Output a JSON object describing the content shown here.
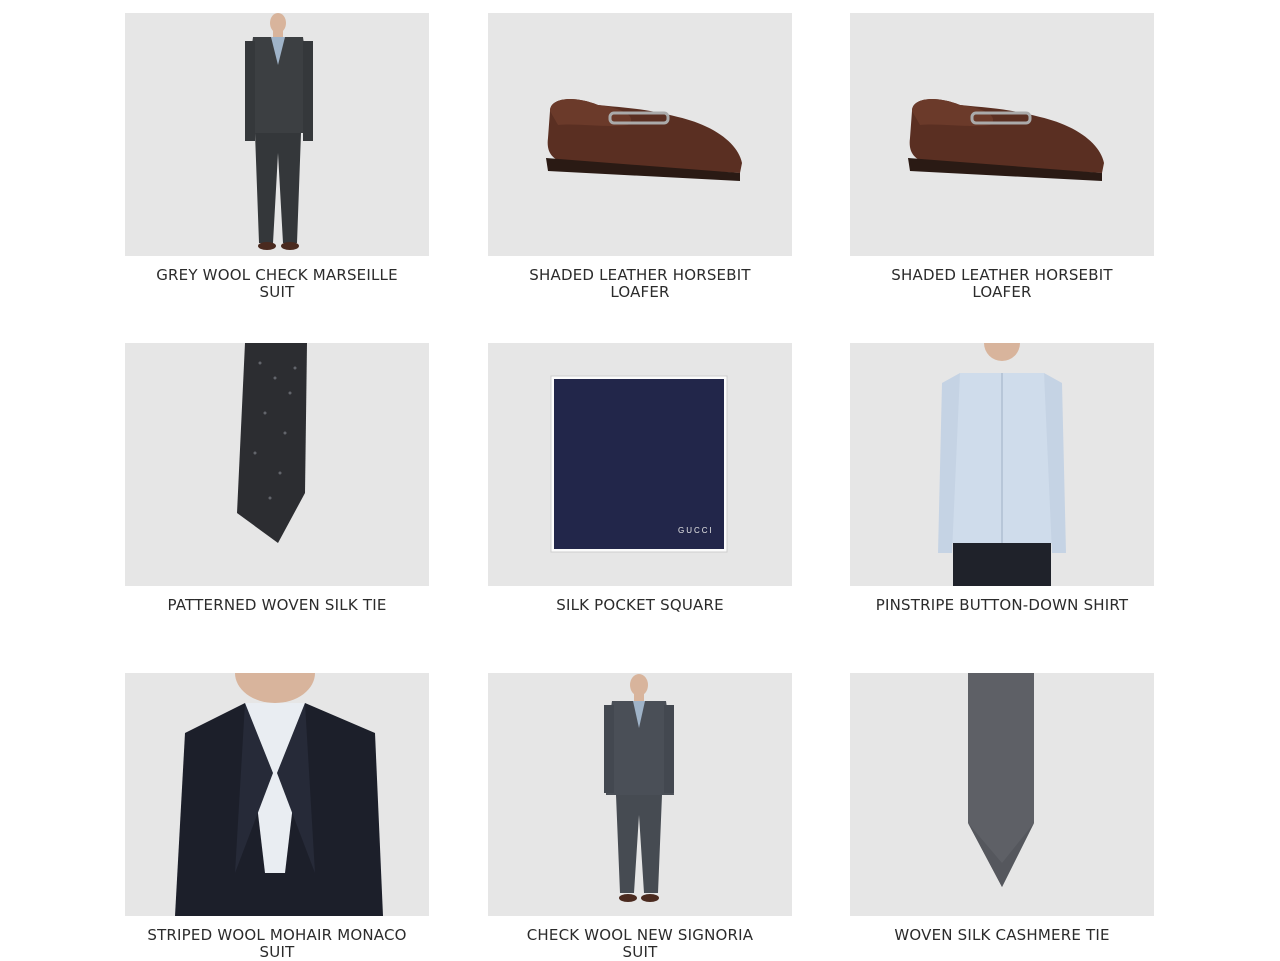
{
  "products": [
    {
      "name": "GREY WOOL CHECK MARSEILLE SUIT",
      "image_icon": "suit-full-icon"
    },
    {
      "name": "SHADED LEATHER HORSEBIT LOAFER",
      "image_icon": "loafer-icon"
    },
    {
      "name": "SHADED LEATHER HORSEBIT LOAFER",
      "image_icon": "loafer-icon"
    },
    {
      "name": "PATTERNED WOVEN SILK TIE",
      "image_icon": "tie-dark-icon"
    },
    {
      "name": "SILK POCKET SQUARE",
      "image_icon": "pocket-square-icon",
      "image_text": "GUCCI"
    },
    {
      "name": "PINSTRIPE BUTTON-DOWN SHIRT",
      "image_icon": "shirt-icon"
    },
    {
      "name": "STRIPED WOOL MOHAIR MONACO SUIT",
      "image_icon": "suit-closeup-icon"
    },
    {
      "name": "CHECK WOOL NEW SIGNORIA SUIT",
      "image_icon": "suit-full-icon"
    },
    {
      "name": "WOVEN SILK CASHMERE TIE",
      "image_icon": "tie-grey-icon"
    }
  ],
  "colors": {
    "tile_background": "#e6e6e6",
    "caption_text": "#2b2b2b",
    "pocket_square_navy": "#22264a",
    "loafer_brown": "#5a2f22"
  }
}
